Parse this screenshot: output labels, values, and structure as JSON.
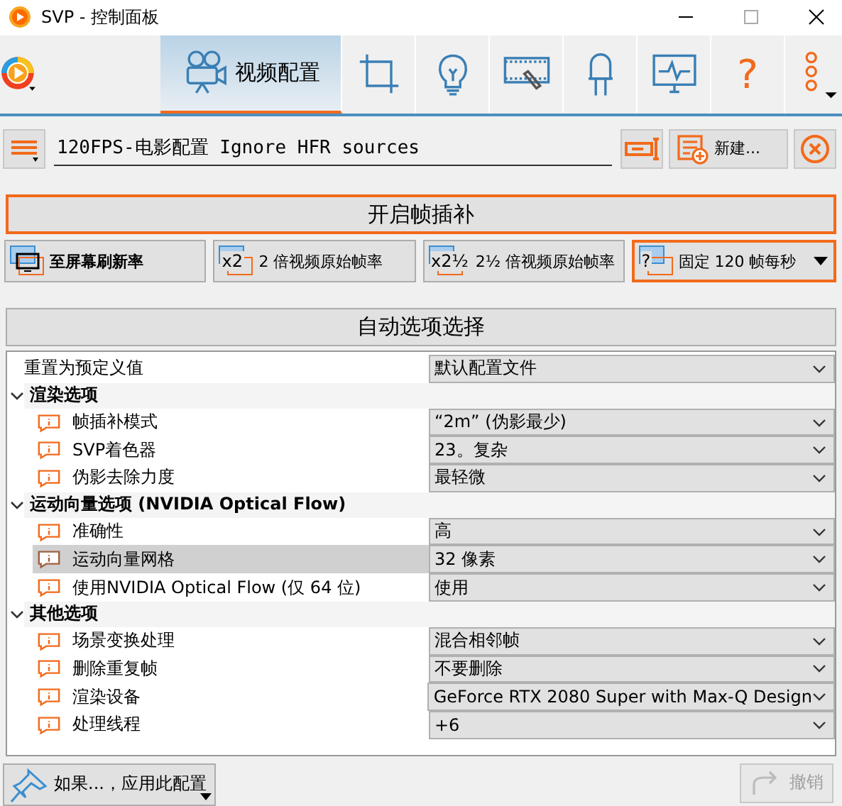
{
  "window": {
    "title": "SVP - 控制面板"
  },
  "toolbar": {
    "tabs": [
      {
        "kind": "camera",
        "label": "视频配置",
        "selected": true
      },
      {
        "kind": "crop",
        "selected": false
      },
      {
        "kind": "bulb",
        "selected": false
      },
      {
        "kind": "film",
        "selected": false
      },
      {
        "kind": "led",
        "selected": false
      },
      {
        "kind": "monitor",
        "selected": false
      },
      {
        "kind": "help",
        "label": "?",
        "selected": false
      },
      {
        "kind": "more",
        "selected": false
      }
    ]
  },
  "profile": {
    "name": "120FPS-电影配置 Ignore HFR sources",
    "new_button": "新建..."
  },
  "enable_button": "开启帧插补",
  "modes": [
    {
      "label": "至屏幕刷新率",
      "emphasized": true,
      "selected": false
    },
    {
      "badge": "x2",
      "label": "2 倍视频原始帧率",
      "emphasized": false,
      "selected": false
    },
    {
      "badge": "x2½",
      "label": "2½ 倍视频原始帧率",
      "emphasized": false,
      "selected": false
    },
    {
      "badge": "?",
      "label": "固定 120 帧每秒",
      "emphasized": false,
      "selected": true
    }
  ],
  "auto_button": "自动选项选择",
  "properties": [
    {
      "kind": "plain",
      "label": "重置为预定义值",
      "value": "默认配置文件",
      "selected": false
    },
    {
      "kind": "group",
      "label": "渲染选项",
      "expanded": true,
      "children": [
        {
          "kind": "option",
          "label": "帧插补模式",
          "value": "“2m” (伪影最少)",
          "selected": false
        },
        {
          "kind": "option",
          "label": "SVP着色器",
          "value": "23。复杂",
          "selected": false
        },
        {
          "kind": "option",
          "label": "伪影去除力度",
          "value": "最轻微",
          "selected": false
        }
      ]
    },
    {
      "kind": "group",
      "label": "运动向量选项 (NVIDIA Optical Flow)",
      "expanded": true,
      "children": [
        {
          "kind": "option",
          "label": "准确性",
          "value": "高",
          "selected": false
        },
        {
          "kind": "option",
          "label": "运动向量网格",
          "value": "32 像素",
          "selected": true
        },
        {
          "kind": "option",
          "label": "使用NVIDIA Optical Flow (仅 64 位)",
          "value": "使用",
          "selected": false
        }
      ]
    },
    {
      "kind": "group",
      "label": "其他选项",
      "expanded": true,
      "children": [
        {
          "kind": "option",
          "label": "场景变换处理",
          "value": "混合相邻帧",
          "selected": false
        },
        {
          "kind": "option",
          "label": "删除重复帧",
          "value": "不要删除",
          "selected": false
        },
        {
          "kind": "option",
          "label": "渲染设备",
          "value": "GeForce RTX 2080 Super with Max-Q Design",
          "selected": false
        },
        {
          "kind": "option",
          "label": "处理线程",
          "value": "+6",
          "selected": false
        }
      ]
    }
  ],
  "bottom": {
    "apply_button": "如果...，应用此配置",
    "undo_button": {
      "label": "撤销",
      "disabled": true
    }
  }
}
